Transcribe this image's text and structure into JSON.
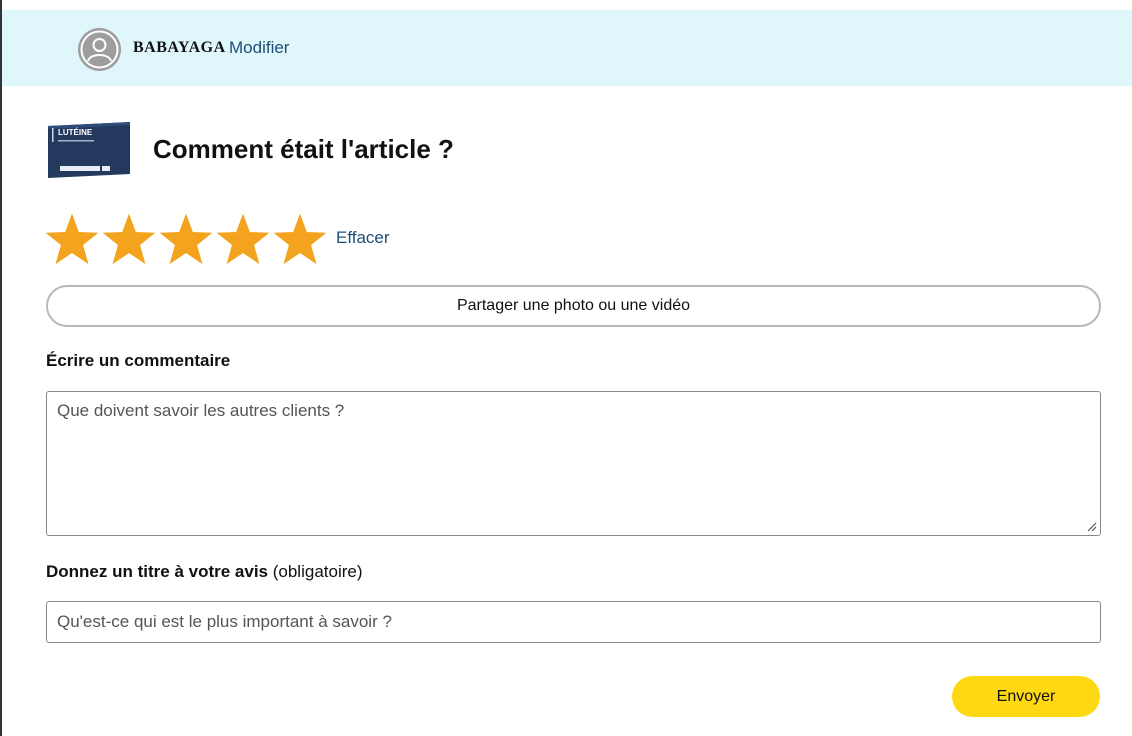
{
  "header": {
    "username": "BABAYAGA",
    "modify_label": "Modifier",
    "background_color": "#dff6fb",
    "avatar_icon": "user-avatar-icon"
  },
  "product": {
    "thumbnail_label": "LUTÉINE",
    "question": "Comment était l'article ?"
  },
  "rating": {
    "value": 5,
    "max": 5,
    "star_color": "#f3a31d",
    "clear_label": "Effacer"
  },
  "media": {
    "share_label": "Partager une photo ou une vidéo"
  },
  "comment": {
    "label": "Écrire un commentaire",
    "placeholder": "Que doivent savoir les autres clients ?",
    "value": ""
  },
  "review_title": {
    "label": "Donnez un titre à votre avis",
    "required_note": "(obligatoire)",
    "placeholder": "Qu'est-ce qui est le plus important à savoir ?",
    "value": ""
  },
  "submit": {
    "label": "Envoyer",
    "color": "#ffd814"
  }
}
